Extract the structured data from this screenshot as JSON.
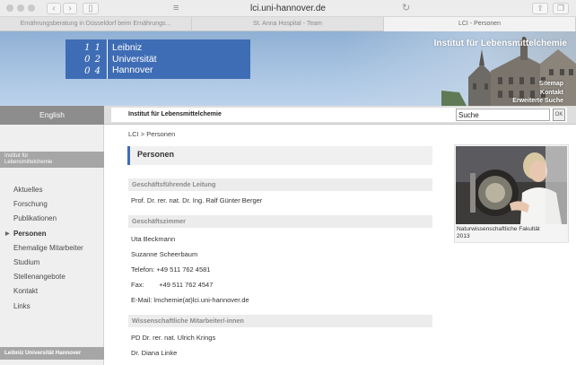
{
  "browser": {
    "url": "lci.uni-hannover.de",
    "tabs": [
      {
        "label": "Ernährungsberatung in Düsseldorf beim Ernährungs...",
        "active": false
      },
      {
        "label": "St. Anna Hospital - Team",
        "active": false
      },
      {
        "label": "LCI - Personen",
        "active": true
      }
    ]
  },
  "banner": {
    "logo_numbers": [
      "1 1",
      "0 2",
      "0 4"
    ],
    "logo_name": [
      "Leibniz",
      "Universität",
      "Hannover"
    ],
    "institute_title": "Institut für Lebensmittelchemie",
    "links": [
      "Sitemap",
      "Kontakt",
      "Erweiterte Suche"
    ]
  },
  "navbar": {
    "language": "English",
    "title": "Institut für Lebensmittelchemie",
    "search_value": "Suche",
    "search_button": "OK"
  },
  "sidebar": {
    "institute": [
      "Institut für",
      "Lebensmittelchemie"
    ],
    "items": [
      {
        "label": "Aktuelles",
        "active": false
      },
      {
        "label": "Forschung",
        "active": false
      },
      {
        "label": "Publikationen",
        "active": false
      },
      {
        "label": "Personen",
        "active": true
      },
      {
        "label": "Ehemalige Mitarbeiter",
        "active": false
      },
      {
        "label": "Studium",
        "active": false
      },
      {
        "label": "Stellenangebote",
        "active": false
      },
      {
        "label": "Kontakt",
        "active": false
      },
      {
        "label": "Links",
        "active": false
      }
    ],
    "footer": "Leibniz Universität Hannover"
  },
  "main": {
    "breadcrumb": "LCI > Personen",
    "title": "Personen",
    "sections": [
      {
        "heading": "Geschäftsführende Leitung",
        "lines": [
          "Prof. Dr. rer. nat. Dr. Ing. Ralf Günter Berger"
        ]
      },
      {
        "heading": "Geschäftszimmer",
        "lines": [
          "Uta Beckmann",
          "Suzanne Scheerbaum",
          "Telefon: +49 511 762 4581",
          "Fax:        +49 511 762 4547",
          "E-Mail: lmchemie(at)lci.uni-hannover.de"
        ]
      },
      {
        "heading": "Wissenschaftliche Mitarbeiter/-innen",
        "lines": [
          "PD Dr. rer. nat. Ulrich Krings",
          "Dr. Diana Linke"
        ]
      }
    ]
  },
  "photo": {
    "caption": [
      "Naturwissenschaftliche Fakultät",
      "2013"
    ]
  },
  "colors": {
    "accent": "#3f6db5",
    "sidebar_bg": "#efefef",
    "section_bg": "#ececec"
  }
}
